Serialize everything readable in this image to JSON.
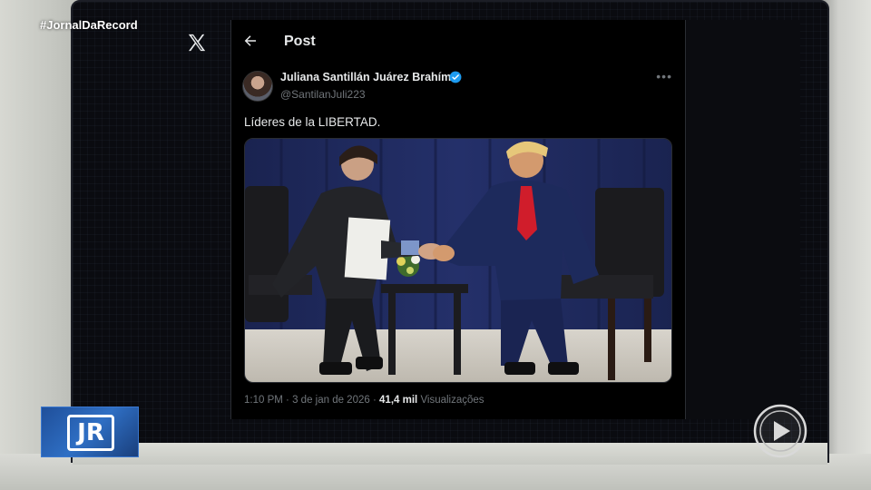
{
  "broadcast": {
    "hashtag": "#JornalDaRecord",
    "program_logo_text": "JR"
  },
  "app": {
    "logo_icon": "x-logo-icon"
  },
  "header": {
    "back_icon": "arrow-left-icon",
    "title": "Post"
  },
  "post": {
    "author_name": "Juliana Santillán Juárez Brahím",
    "verified_icon": "verified-badge-icon",
    "handle": "@SantilanJuli223",
    "more_icon": "more-options-icon",
    "text": "Líderes de la LIBERTAD.",
    "time": "1:10 PM",
    "separator": "·",
    "date": "3 de jan de 2026",
    "views_count": "41,4 mil",
    "views_label": "Visualizações"
  },
  "colors": {
    "background": "#000000",
    "text_primary": "#e7e9ea",
    "text_secondary": "#71767b",
    "verified": "#1d9bf0",
    "program_blue": "#2f6fc4"
  }
}
